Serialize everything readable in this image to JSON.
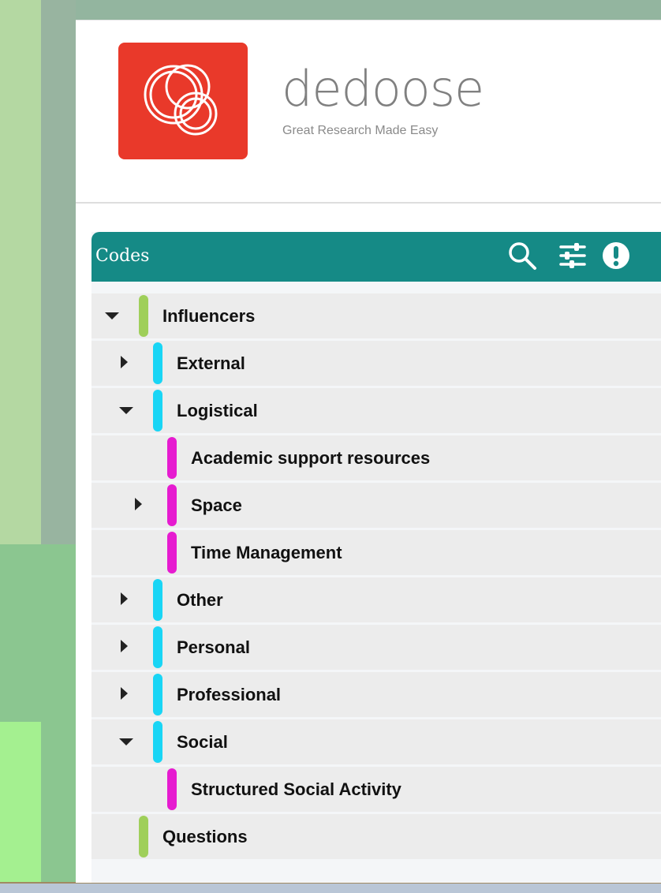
{
  "brand": {
    "name": "dedoose",
    "tagline": "Great Research Made Easy"
  },
  "codes_panel": {
    "title": "Codes",
    "header_icons": [
      "search-icon",
      "filter-sliders-icon",
      "alert-icon"
    ],
    "rows": [
      {
        "label": "Influencers",
        "level": 0,
        "toggle": "expanded",
        "color": "#9fcf5a"
      },
      {
        "label": "External",
        "level": 1,
        "toggle": "collapsed",
        "color": "#19d5f5"
      },
      {
        "label": "Logistical",
        "level": 1,
        "toggle": "expanded",
        "color": "#19d5f5"
      },
      {
        "label": "Academic support resources",
        "level": 2,
        "toggle": "none",
        "color": "#e61bd0"
      },
      {
        "label": "Space",
        "level": 2,
        "toggle": "collapsed",
        "color": "#e61bd0"
      },
      {
        "label": "Time Management",
        "level": 2,
        "toggle": "none",
        "color": "#e61bd0"
      },
      {
        "label": "Other",
        "level": 1,
        "toggle": "collapsed",
        "color": "#19d5f5"
      },
      {
        "label": "Personal",
        "level": 1,
        "toggle": "collapsed",
        "color": "#19d5f5"
      },
      {
        "label": "Professional",
        "level": 1,
        "toggle": "collapsed",
        "color": "#19d5f5"
      },
      {
        "label": "Social",
        "level": 1,
        "toggle": "expanded",
        "color": "#19d5f5"
      },
      {
        "label": "Structured Social Activity",
        "level": 2,
        "toggle": "none",
        "color": "#e61bd0"
      },
      {
        "label": "Questions",
        "level": 0,
        "toggle": "none",
        "color": "#9fcf5a"
      }
    ]
  },
  "colors": {
    "brand_red": "#e9392a",
    "panel_header_teal": "#158a86"
  }
}
